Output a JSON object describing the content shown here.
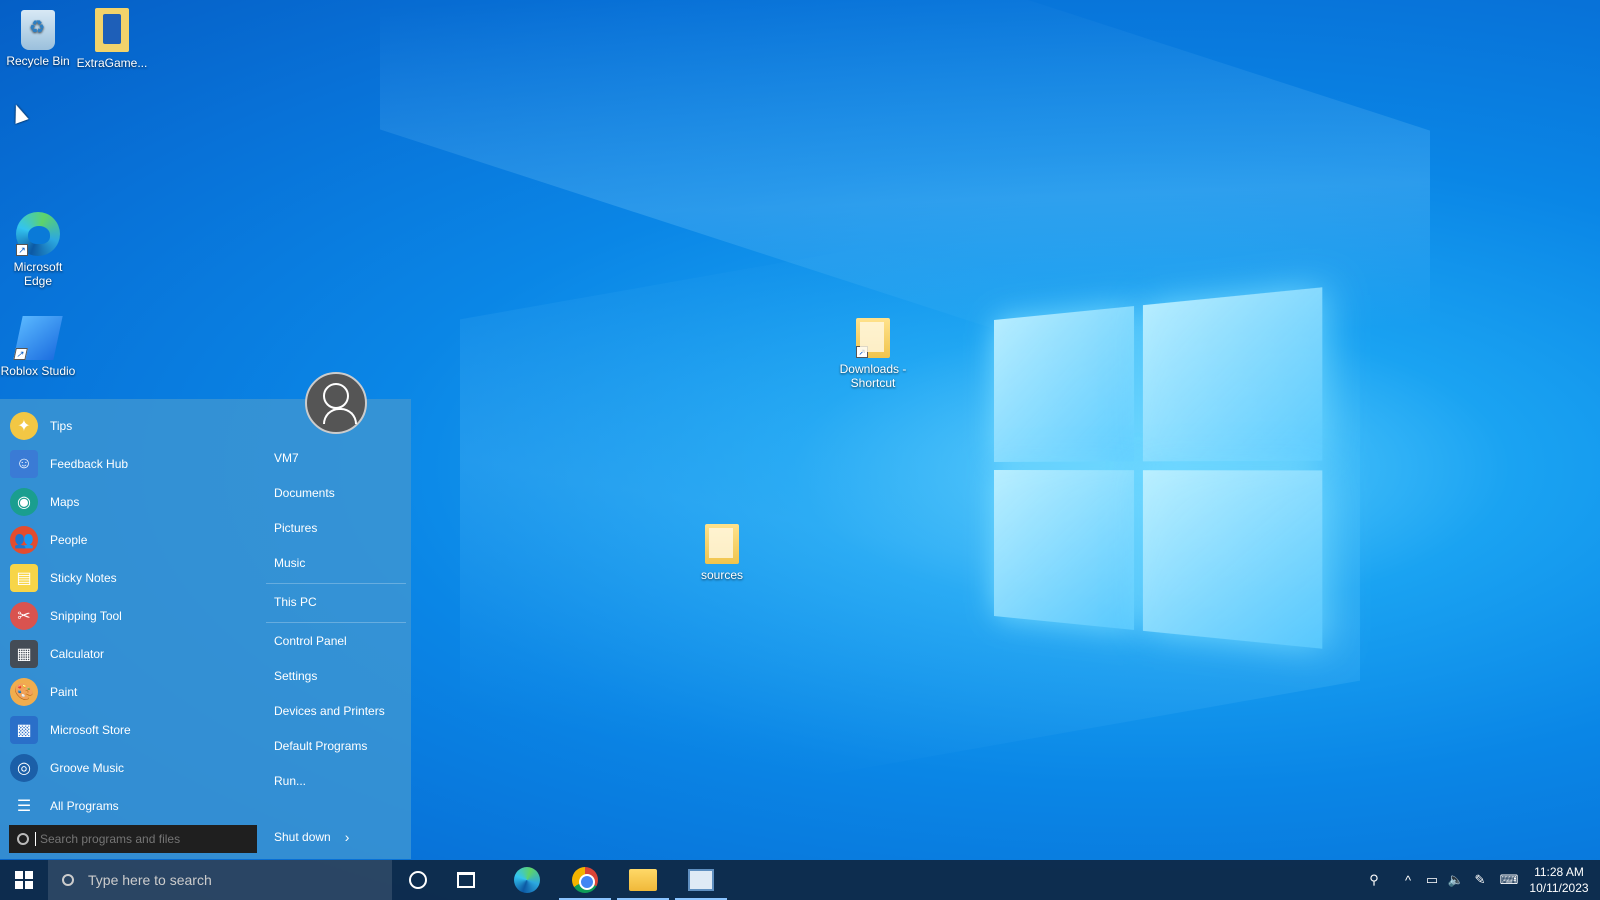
{
  "desktop": {
    "icons": [
      {
        "label": "Recycle Bin"
      },
      {
        "label": "ExtraGame..."
      },
      {
        "label": "Microsoft Edge"
      },
      {
        "label": "Roblox Studio"
      },
      {
        "label": "Downloads - Shortcut"
      },
      {
        "label": "sources"
      }
    ]
  },
  "start_menu": {
    "programs": [
      {
        "label": "Tips"
      },
      {
        "label": "Feedback Hub"
      },
      {
        "label": "Maps"
      },
      {
        "label": "People"
      },
      {
        "label": "Sticky Notes"
      },
      {
        "label": "Snipping Tool"
      },
      {
        "label": "Calculator"
      },
      {
        "label": "Paint"
      },
      {
        "label": "Microsoft Store"
      },
      {
        "label": "Groove Music"
      },
      {
        "label": "All Programs"
      }
    ],
    "search_placeholder": "Search programs and files",
    "user_name": "VM7",
    "links": [
      {
        "label": "Documents"
      },
      {
        "label": "Pictures"
      },
      {
        "label": "Music"
      },
      {
        "label": "This PC"
      },
      {
        "label": "Control Panel"
      },
      {
        "label": "Settings"
      },
      {
        "label": "Devices and Printers"
      },
      {
        "label": "Default Programs"
      },
      {
        "label": "Run..."
      }
    ],
    "shutdown_label": "Shut down"
  },
  "taskbar": {
    "search_placeholder": "Type here to search",
    "time": "11:28 AM",
    "date": "10/11/2023"
  }
}
